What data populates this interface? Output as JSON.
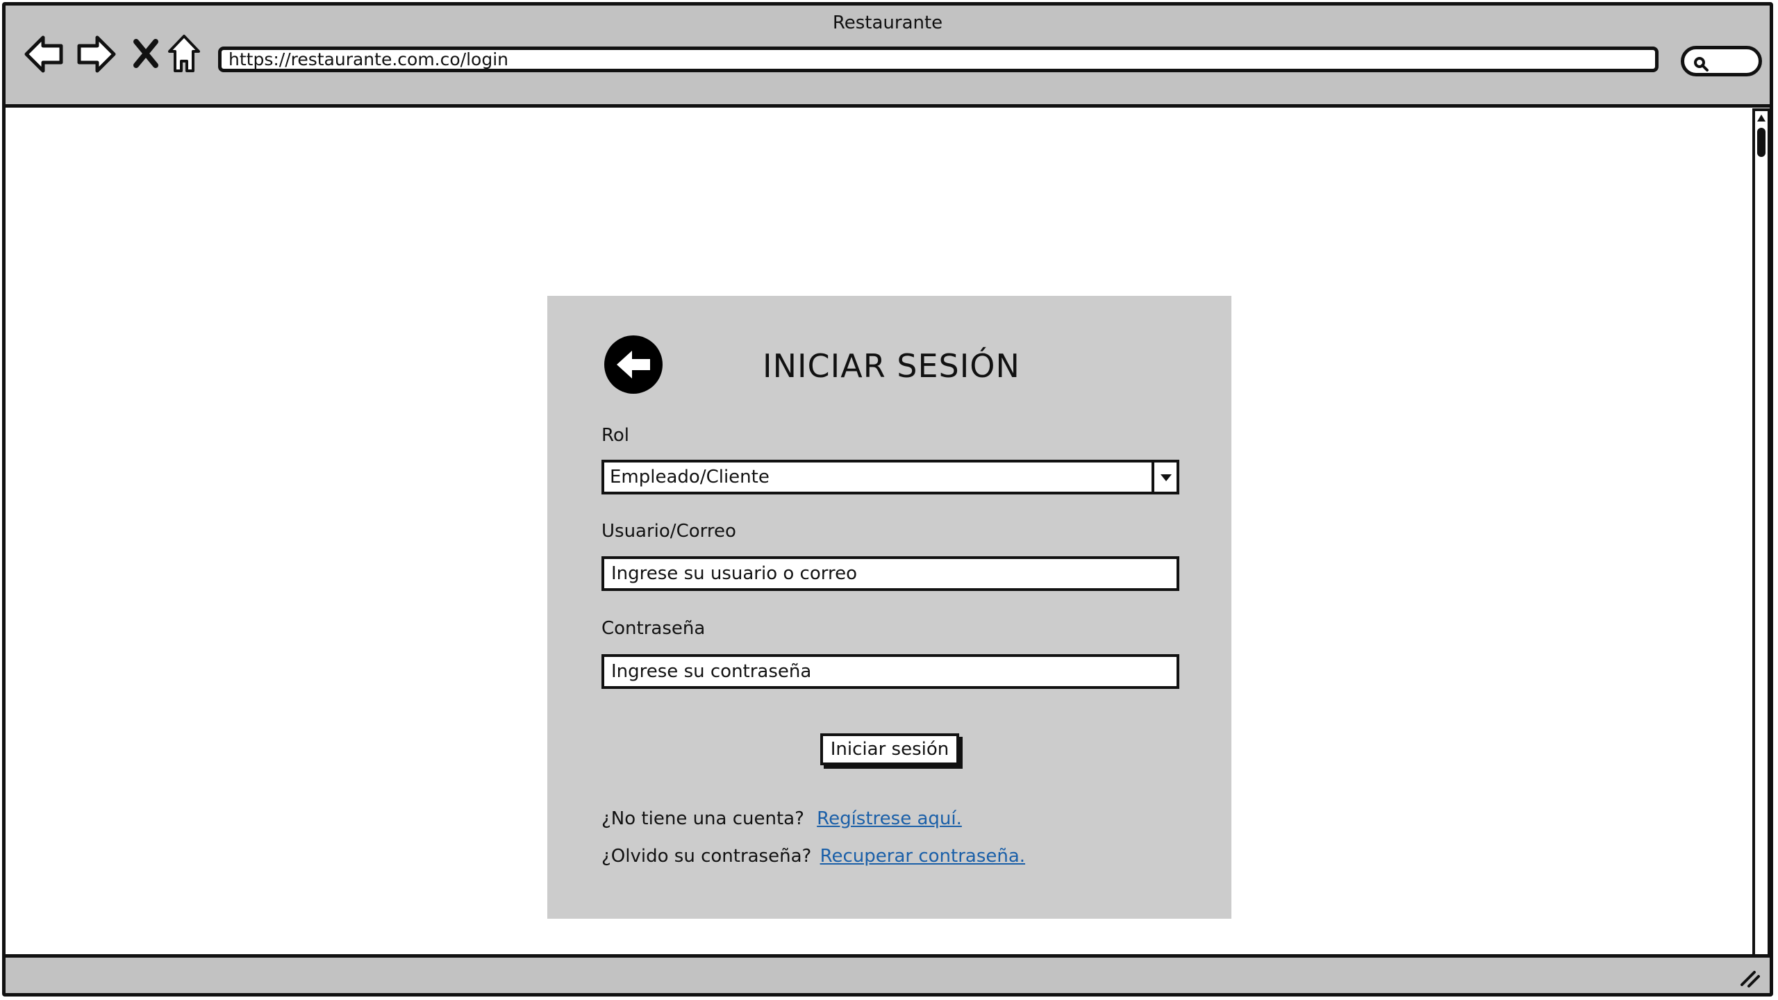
{
  "window": {
    "title": "Restaurante",
    "url": "https://restaurante.com.co/login"
  },
  "browser_icons": [
    "back-arrow-icon",
    "forward-arrow-icon",
    "stop-icon",
    "home-icon",
    "search-icon"
  ],
  "login": {
    "title": "INICIAR SESIÓN",
    "role_label": "Rol",
    "role_value": "Empleado/Cliente",
    "user_label": "Usuario/Correo",
    "user_placeholder": "Ingrese su usuario o correo",
    "password_label": "Contraseña",
    "password_placeholder": "Ingrese su contraseña",
    "submit_label": "Iniciar sesión",
    "register_prompt": "¿No tiene una cuenta?",
    "register_link": "Regístrese aquí.",
    "recover_prompt": "¿Olvido su contraseña?",
    "recover_link": "Recuperar contraseña."
  },
  "colors": {
    "chrome_gray": "#c2c2c2",
    "card_gray": "#cccccc",
    "link_blue": "#1a5fa8"
  }
}
